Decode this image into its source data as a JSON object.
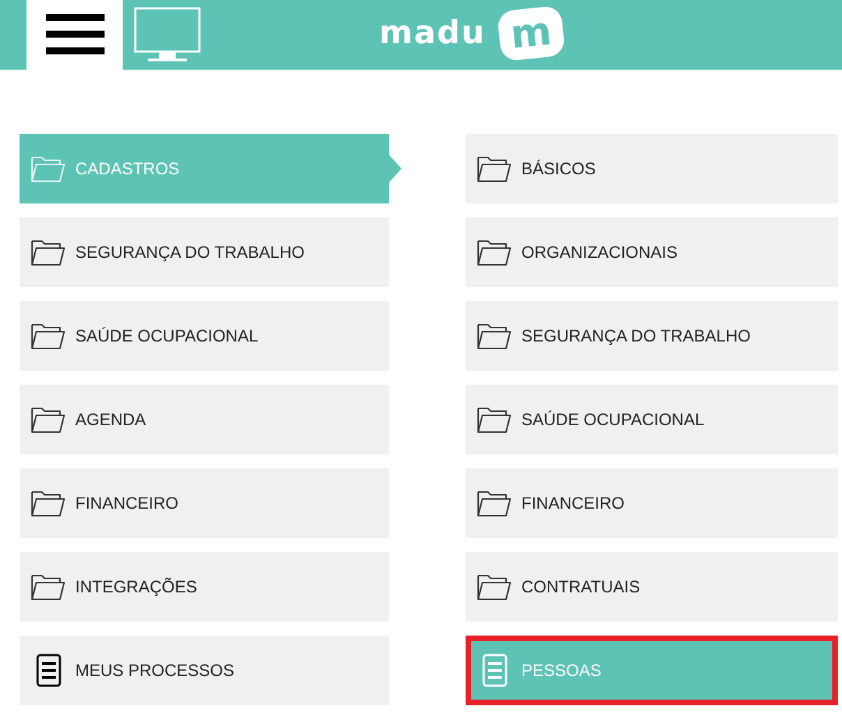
{
  "header": {
    "logo": {
      "text": "madu",
      "badge": "m"
    }
  },
  "menu_columns": [
    {
      "items": [
        {
          "label": "CADASTROS",
          "kind": "folder",
          "selected": true,
          "outlined": false
        },
        {
          "label": "SEGURANÇA DO TRABALHO",
          "kind": "folder",
          "selected": false,
          "outlined": false
        },
        {
          "label": "SAÚDE OCUPACIONAL",
          "kind": "folder",
          "selected": false,
          "outlined": false
        },
        {
          "label": "AGENDA",
          "kind": "folder",
          "selected": false,
          "outlined": false
        },
        {
          "label": "FINANCEIRO",
          "kind": "folder",
          "selected": false,
          "outlined": false
        },
        {
          "label": "INTEGRAÇÕES",
          "kind": "folder",
          "selected": false,
          "outlined": false
        },
        {
          "label": "MEUS PROCESSOS",
          "kind": "document",
          "selected": false,
          "outlined": false
        }
      ]
    },
    {
      "items": [
        {
          "label": "BÁSICOS",
          "kind": "folder",
          "selected": false,
          "outlined": false
        },
        {
          "label": "ORGANIZACIONAIS",
          "kind": "folder",
          "selected": false,
          "outlined": false
        },
        {
          "label": "SEGURANÇA DO TRABALHO",
          "kind": "folder",
          "selected": false,
          "outlined": false
        },
        {
          "label": "SAÚDE OCUPACIONAL",
          "kind": "folder",
          "selected": false,
          "outlined": false
        },
        {
          "label": "FINANCEIRO",
          "kind": "folder",
          "selected": false,
          "outlined": false
        },
        {
          "label": "CONTRATUAIS",
          "kind": "folder",
          "selected": false,
          "outlined": false
        },
        {
          "label": "PESSOAS",
          "kind": "document",
          "selected": true,
          "outlined": true
        }
      ]
    }
  ]
}
